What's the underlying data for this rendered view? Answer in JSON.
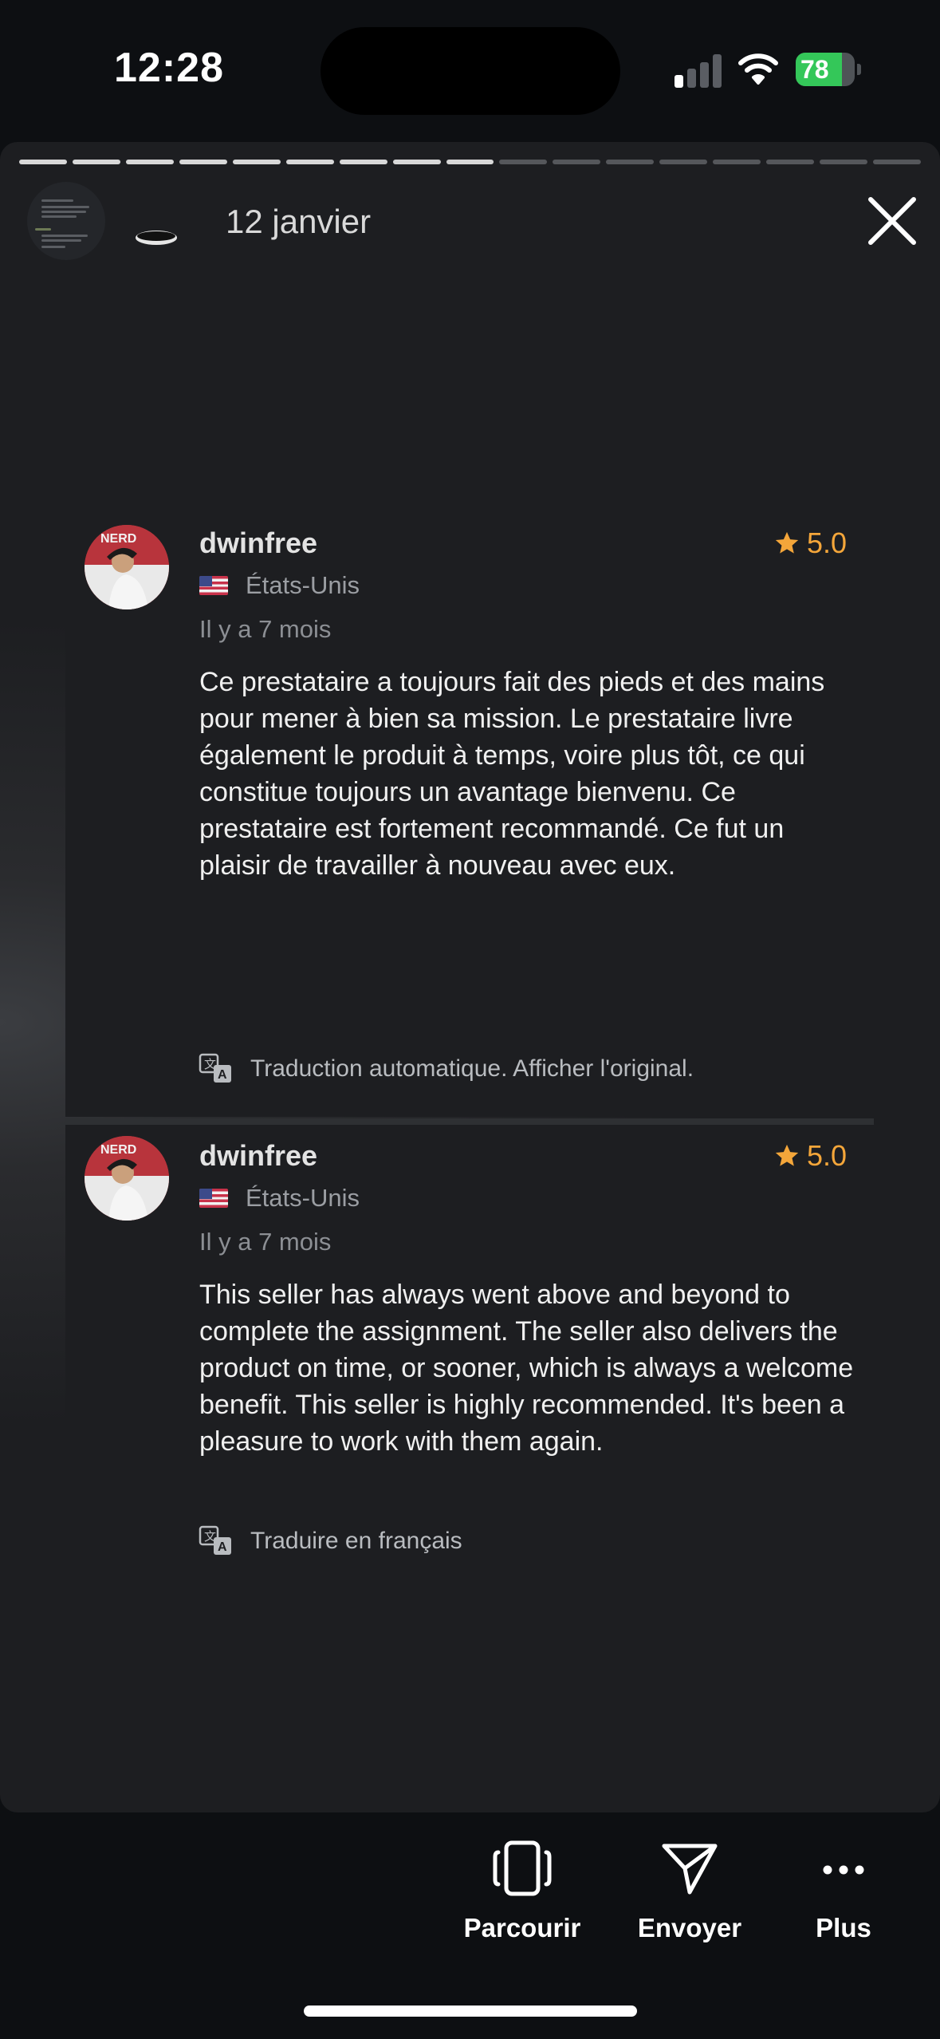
{
  "status_bar": {
    "time": "12:28",
    "battery_level": "78",
    "battery_percent": 78,
    "battery_color": "#34c759",
    "signal_bars_active": 1,
    "signal_bars_total": 4,
    "wifi_icon": "wifi-icon"
  },
  "story": {
    "date": "12 janvier",
    "progress_segments_total": 17,
    "progress_segments_done": 9,
    "close_icon": "close-icon"
  },
  "reviews": [
    {
      "username": "dwinfree",
      "rating": "5.0",
      "country": "États-Unis",
      "flag_icon": "us-flag-icon",
      "time_ago": "Il y a 7 mois",
      "text": "Ce prestataire a toujours fait des pieds et des mains pour mener à bien sa mission. Le prestataire livre également le produit à temps, voire plus tôt, ce qui constitue toujours un avantage bienvenu. Ce prestataire est fortement recommandé. Ce fut un plaisir de travailler à nouveau avec eux.",
      "translate_label": "Traduction automatique. Afficher l'original."
    },
    {
      "username": "dwinfree",
      "rating": "5.0",
      "country": "États-Unis",
      "flag_icon": "us-flag-icon",
      "time_ago": "Il y a 7 mois",
      "text": "This seller has always went above and beyond to complete the assignment. The seller also delivers the product on time, or sooner, which is always a welcome benefit. This seller is highly recommended. It's been a pleasure to work with them again.",
      "translate_label": "Traduire en français"
    }
  ],
  "toolbar": {
    "browse_label": "Parcourir",
    "send_label": "Envoyer",
    "more_label": "Plus"
  },
  "colors": {
    "accent_star": "#f4a63a",
    "background": "#0d0f12",
    "card": "#1d1e21"
  }
}
